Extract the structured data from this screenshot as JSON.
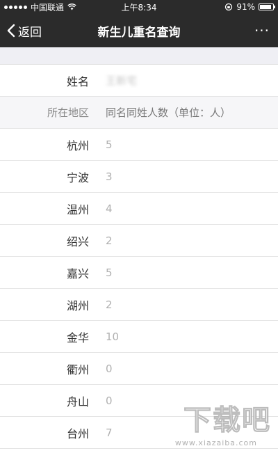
{
  "status_bar": {
    "carrier": "中国联通",
    "time": "上午8:34",
    "battery_percent": "91%",
    "battery_level": 0.91
  },
  "nav": {
    "back_label": "返回",
    "title": "新生儿重名查询",
    "more_label": "···"
  },
  "form": {
    "name_label": "姓名",
    "name_value": "王新宅",
    "header_region": "所在地区",
    "header_count": "同名同姓人数（单位：人）"
  },
  "rows": [
    {
      "region": "杭州",
      "count": "5"
    },
    {
      "region": "宁波",
      "count": "3"
    },
    {
      "region": "温州",
      "count": "4"
    },
    {
      "region": "绍兴",
      "count": "2"
    },
    {
      "region": "嘉兴",
      "count": "5"
    },
    {
      "region": "湖州",
      "count": "2"
    },
    {
      "region": "金华",
      "count": "10"
    },
    {
      "region": "衢州",
      "count": "0"
    },
    {
      "region": "舟山",
      "count": "0"
    },
    {
      "region": "台州",
      "count": "7"
    }
  ],
  "watermark": {
    "logo_text": "下载吧",
    "url": "www.xiazaiba.com"
  },
  "colors": {
    "bar_bg": "#2b2b2b",
    "page_bg": "#ffffff",
    "spacer_bg": "#efeff4"
  }
}
